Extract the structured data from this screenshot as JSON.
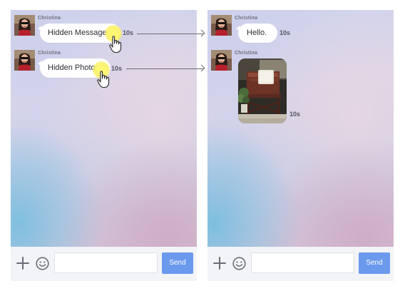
{
  "left_panel": {
    "messages": [
      {
        "sender": "Christina",
        "text": "Hidden Message",
        "timer": "10s"
      },
      {
        "sender": "Christina",
        "text": "Hidden Photo",
        "timer": "10s"
      }
    ],
    "input": {
      "placeholder": "",
      "value": ""
    },
    "send_label": "Send"
  },
  "right_panel": {
    "messages": [
      {
        "sender": "Christina",
        "text": "Hello.",
        "timer": "10s"
      },
      {
        "sender": "Christina",
        "type": "photo",
        "timer": "10s"
      }
    ],
    "input": {
      "placeholder": "",
      "value": ""
    },
    "send_label": "Send"
  },
  "icons": {
    "plus": "plus-icon",
    "smile": "emoji-icon",
    "cursor": "hand-pointer-icon",
    "arrow": "arrow-right-icon"
  },
  "colors": {
    "send_button": "#6b99ed",
    "highlight": "#f5ef6a",
    "bubble": "#ffffff"
  }
}
